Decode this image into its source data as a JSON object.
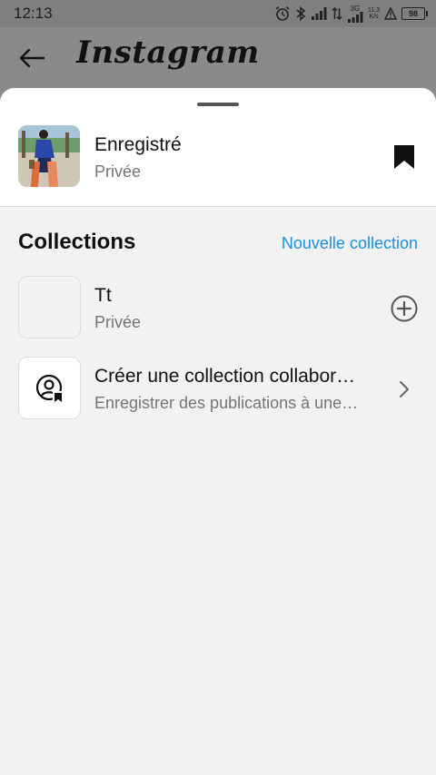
{
  "status_bar": {
    "time": "12:13",
    "network_3g": "3G",
    "speed_value": "11,3",
    "speed_unit": "K/s",
    "battery": "98"
  },
  "header": {
    "app_name": "Instagram"
  },
  "saved": {
    "title": "Enregistré",
    "privacy": "Privée"
  },
  "collections": {
    "heading": "Collections",
    "new_label": "Nouvelle collection",
    "items": [
      {
        "title": "Tt",
        "privacy": "Privée"
      }
    ],
    "collab": {
      "title": "Créer une collection collabor…",
      "subtitle": "Enregistrer des publications à une…"
    }
  },
  "colors": {
    "accent": "#1a8fe0",
    "overlay": "#8a8a8a",
    "sheet_bg": "#f2f2f2"
  },
  "icons": [
    "back-arrow-icon",
    "bookmark-icon",
    "plus-circle-icon",
    "collab-user-icon",
    "chevron-right-icon",
    "alarm-icon",
    "bluetooth-icon",
    "signal-icon"
  ]
}
